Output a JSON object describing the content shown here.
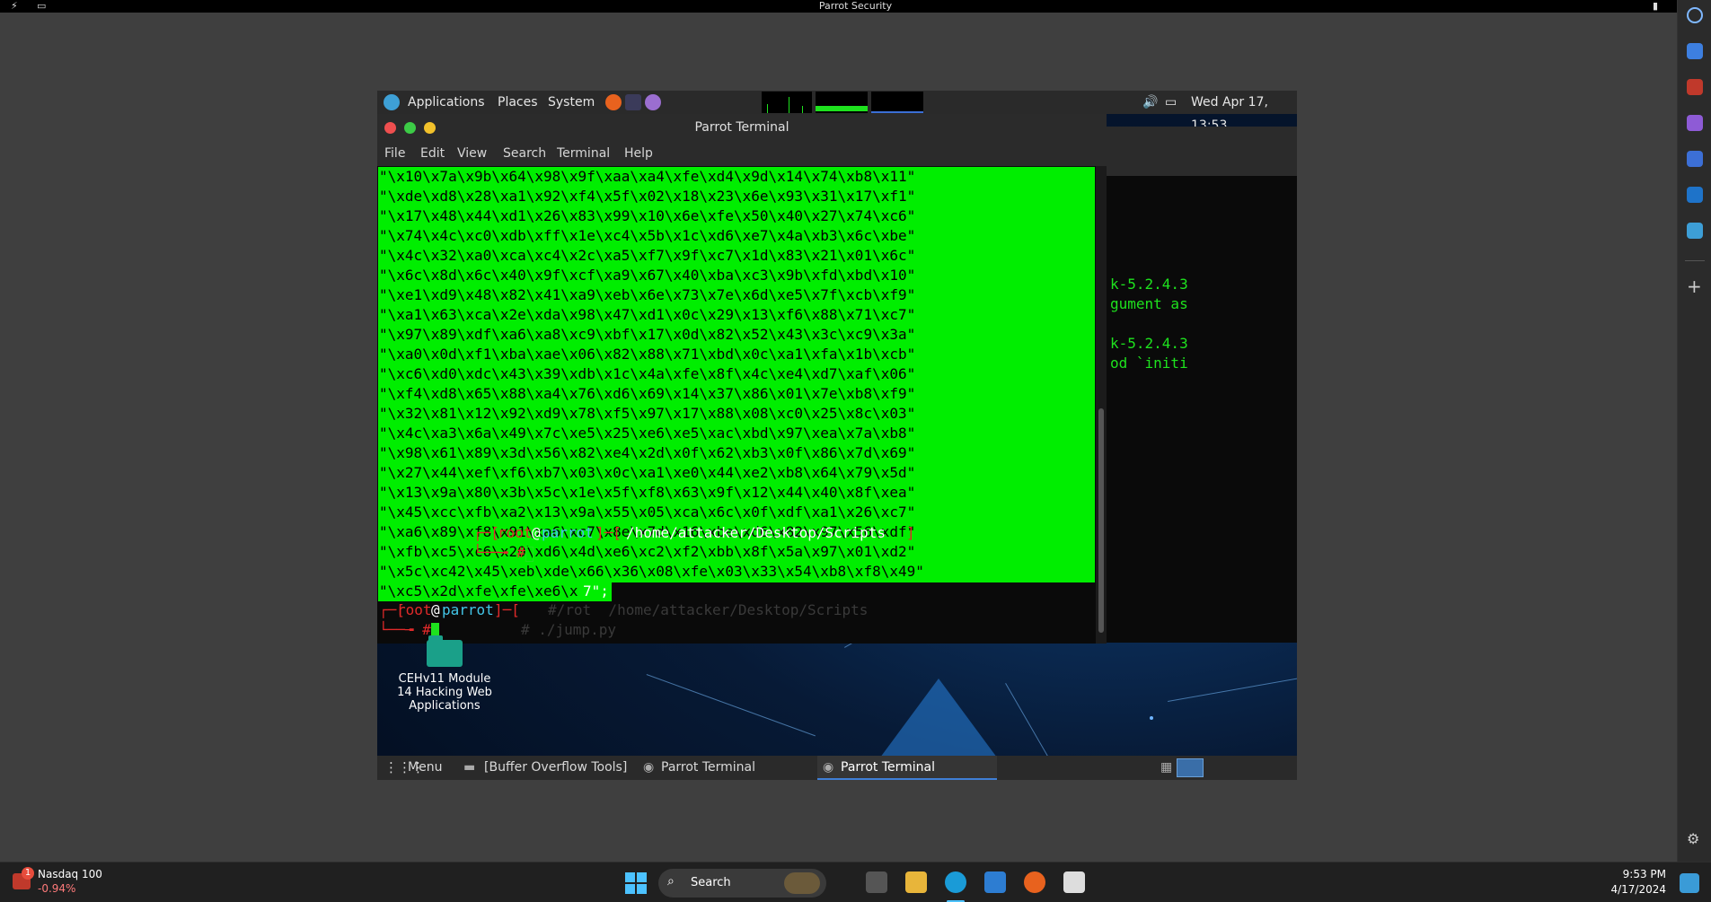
{
  "host": {
    "title": "Parrot Security"
  },
  "parrot_panel": {
    "applications": "Applications",
    "places": "Places",
    "system": "System",
    "clock": "Wed Apr 17, 13:53"
  },
  "terminal": {
    "title": "Parrot Terminal",
    "menu": [
      "File",
      "Edit",
      "View",
      "Search",
      "Terminal",
      "Help"
    ],
    "hex_lines": [
      "\"\\x10\\x7a\\x9b\\x64\\x98\\x9f\\xaa\\xa4\\xfe\\xd4\\x9d\\x14\\x74\\xb8\\x11\"",
      "\"\\xde\\xd8\\x28\\xa1\\x92\\xf4\\x5f\\x02\\x18\\x23\\x6e\\x93\\x31\\x17\\xf1\"",
      "\"\\x17\\x48\\x44\\xd1\\x26\\x83\\x99\\x10\\x6e\\xfe\\x50\\x40\\x27\\x74\\xc6\"",
      "\"\\x74\\x4c\\xc0\\xdb\\xff\\x1e\\xc4\\x5b\\x1c\\xd6\\xe7\\x4a\\xb3\\x6c\\xbe\"",
      "\"\\x4c\\x32\\xa0\\xca\\xc4\\x2c\\xa5\\xf7\\x9f\\xc7\\x1d\\x83\\x21\\x01\\x6c\"",
      "\"\\x6c\\x8d\\x6c\\x40\\x9f\\xcf\\xa9\\x67\\x40\\xba\\xc3\\x9b\\xfd\\xbd\\x10\"",
      "\"\\xe1\\xd9\\x48\\x82\\x41\\xa9\\xeb\\x6e\\x73\\x7e\\x6d\\xe5\\x7f\\xcb\\xf9\"",
      "\"\\xa1\\x63\\xca\\x2e\\xda\\x98\\x47\\xd1\\x0c\\x29\\x13\\xf6\\x88\\x71\\xc7\"",
      "\"\\x97\\x89\\xdf\\xa6\\xa8\\xc9\\xbf\\x17\\x0d\\x82\\x52\\x43\\x3c\\xc9\\x3a\"",
      "\"\\xa0\\x0d\\xf1\\xba\\xae\\x06\\x82\\x88\\x71\\xbd\\x0c\\xa1\\xfa\\x1b\\xcb\"",
      "\"\\xc6\\xd0\\xdc\\x43\\x39\\xdb\\x1c\\x4a\\xfe\\x8f\\x4c\\xe4\\xd7\\xaf\\x06\"",
      "\"\\xf4\\xd8\\x65\\x88\\xa4\\x76\\xd6\\x69\\x14\\x37\\x86\\x01\\x7e\\xb8\\xf9\"",
      "\"\\x32\\x81\\x12\\x92\\xd9\\x78\\xf5\\x97\\x17\\x88\\x08\\xc0\\x25\\x8c\\x03\"",
      "\"\\x4c\\xa3\\x6a\\x49\\x7c\\xe5\\x25\\xe6\\xe5\\xac\\xbd\\x97\\xea\\x7a\\xb8\"",
      "\"\\x98\\x61\\x89\\x3d\\x56\\x82\\xe4\\x2d\\x0f\\x62\\xb3\\x0f\\x86\\x7d\\x69\"",
      "\"\\x27\\x44\\xef\\xf6\\xb7\\x03\\x0c\\xa1\\xe0\\x44\\xe2\\xb8\\x64\\x79\\x5d\"",
      "\"\\x13\\x9a\\x80\\x3b\\x5c\\x1e\\x5f\\xf8\\x63\\x9f\\x12\\x44\\x40\\x8f\\xea\"",
      "\"\\x45\\xcc\\xfb\\xa2\\x13\\x9a\\x55\\x05\\xca\\x6c\\x0f\\xdf\\xa1\\x26\\xc7\"",
      "\"\\xa6\\x89\\xf8\\x91\\xa6\\xc7\\x8e\\x7d\\x16\\xbe\\xd6\\x82\\x97\\x56\\xdf\"",
      "\"\\xfb\\xc5\\xc6\\x20\\xd6\\x4d\\xe6\\xc2\\xf2\\xbb\\x8f\\x5a\\x97\\x01\\xd2\"",
      "\"\\x5c\\xc42\\x45\\xeb\\xde\\x66\\x36\\x08\\xfe\\x03\\x33\\x54\\xb8\\xf8\\x49\""
    ],
    "last_line_selected": "\"\\xc5\\x2d\\xfe\\xfe\\xe6\\x",
    "last_line_rest": "7\";",
    "prompt": {
      "open": "┌─[",
      "user": "root",
      "at": "@",
      "host": "parrot",
      "close": "]─[",
      "path": "~",
      "end": "]",
      "hash": "└──╼ #"
    },
    "ghost_text": "#/rot  /home/attacker/Desktop/Scripts",
    "ghost_cmd": "# ./jump.py"
  },
  "back_terminal": {
    "line1": "k-5.2.4.3",
    "line2": "gument as",
    "line3": "k-5.2.4.3",
    "line4": "od `initi",
    "prompt_user": "root",
    "prompt_host": "parrot",
    "prompt_path": "/home/attacker/Desktop/Scripts"
  },
  "desktop_icon": {
    "label": "CEHv11 Module 14 Hacking Web Applications"
  },
  "parrot_bottom": {
    "menu": "Menu",
    "items": [
      "[Buffer Overflow Tools]",
      "Parrot Terminal",
      "Parrot Terminal"
    ]
  },
  "taskbar": {
    "stock_name": "Nasdaq 100",
    "stock_change": "-0.94%",
    "badge": "1",
    "search": "Search",
    "time": "9:53 PM",
    "date": "4/17/2024"
  }
}
